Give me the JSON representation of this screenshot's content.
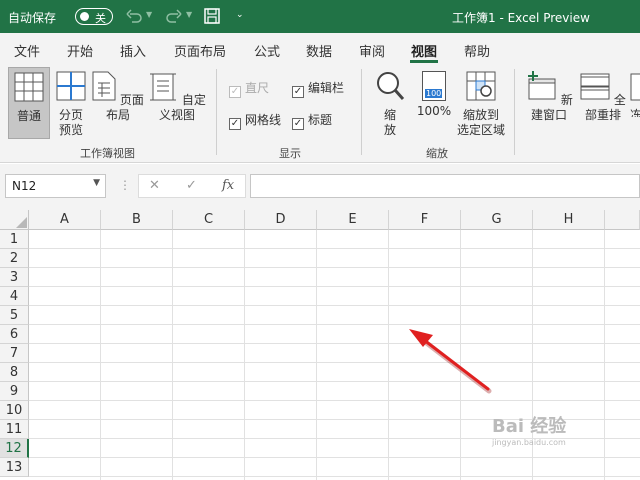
{
  "titlebar": {
    "autosave_label": "自动保存",
    "autosave_state": "关",
    "doc_title": "工作簿1 - Excel Preview"
  },
  "tabs": [
    "文件",
    "开始",
    "插入",
    "页面布局",
    "公式",
    "数据",
    "审阅",
    "视图",
    "帮助"
  ],
  "active_tab": "视图",
  "ribbon": {
    "workbook_views": {
      "normal": "普通",
      "page_break": "分页\n预览",
      "page_layout": "页面布局",
      "custom_views": "自定义视图",
      "label": "工作簿视图"
    },
    "show": {
      "ruler": "直尺",
      "formula_bar": "编辑栏",
      "gridlines": "网格线",
      "headings": "标题",
      "label": "显示"
    },
    "zoom": {
      "zoom": "缩\n放",
      "hundred": "100%",
      "zoom_to_selection": "缩放到\n选定区域",
      "label": "缩放",
      "icon_badge": "100"
    },
    "window": {
      "new_window": "新建窗口",
      "arrange_all": "全部重排",
      "freeze_partial": "冻"
    }
  },
  "formula_bar": {
    "name_box": "N12",
    "fx": "fx"
  },
  "grid": {
    "columns": [
      "A",
      "B",
      "C",
      "D",
      "E",
      "F",
      "G",
      "H"
    ],
    "rows": [
      "1",
      "2",
      "3",
      "4",
      "5",
      "6",
      "7",
      "8",
      "9",
      "10",
      "11",
      "12",
      "13"
    ],
    "selected_row": "12"
  },
  "watermark": {
    "brand": "Bai 经验",
    "url": "jingyan.baidu.com"
  },
  "colors": {
    "excel_green": "#217346",
    "annotation_arrow": "#e02020"
  }
}
